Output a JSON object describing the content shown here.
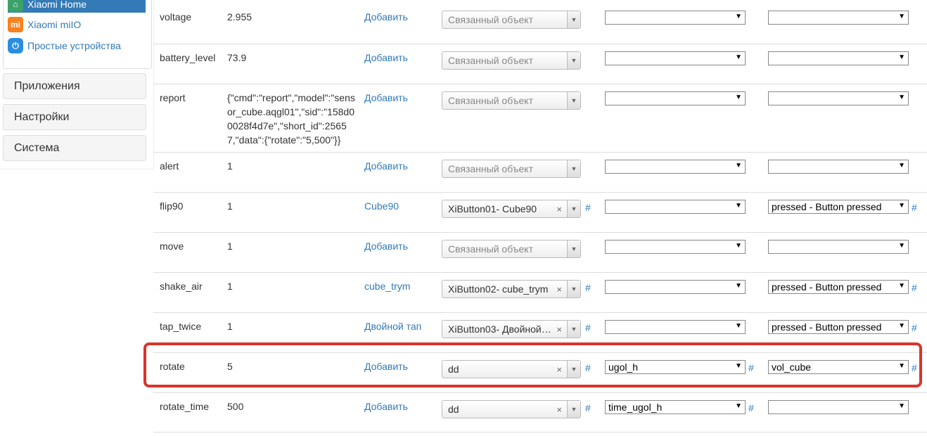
{
  "sidebar": {
    "subitems": [
      {
        "label": "Xiaomi Home",
        "icon": "xiaomi-home-icon"
      },
      {
        "label": "Xiaomi miIO",
        "icon": "mi-icon"
      },
      {
        "label": "Простые устройства",
        "icon": "power-icon"
      }
    ],
    "nav": [
      {
        "label": "Приложения"
      },
      {
        "label": "Настройки"
      },
      {
        "label": "Система"
      }
    ]
  },
  "placeholder_linked": "Связанный объект",
  "hash": "#",
  "rows": [
    {
      "name": "voltage",
      "value": "2.955",
      "link": "Добавить",
      "object": "",
      "prop": "",
      "method": ""
    },
    {
      "name": "battery_level",
      "value": "73.9",
      "link": "Добавить",
      "object": "",
      "prop": "",
      "method": ""
    },
    {
      "name": "report",
      "value": "{\"cmd\":\"report\",\"model\":\"sensor_cube.aqgl01\",\"sid\":\"158d00028f4d7e\",\"short_id\":25657,\"data\":{\"rotate\":\"5,500\"}}",
      "link": "Добавить",
      "object": "",
      "prop": "",
      "method": ""
    },
    {
      "name": "alert",
      "value": "1",
      "link": "Добавить",
      "object": "",
      "prop": "",
      "method": ""
    },
    {
      "name": "flip90",
      "value": "1",
      "link": "Cube90",
      "object": "XiButton01- Cube90",
      "prop": "",
      "method": "pressed - Button pressed"
    },
    {
      "name": "move",
      "value": "1",
      "link": "Добавить",
      "object": "",
      "prop": "",
      "method": ""
    },
    {
      "name": "shake_air",
      "value": "1",
      "link": "cube_trym",
      "object": "XiButton02- cube_trym",
      "prop": "",
      "method": "pressed - Button pressed"
    },
    {
      "name": "tap_twice",
      "value": "1",
      "link": "Двойной тап",
      "object": "XiButton03- Двойной…",
      "prop": "",
      "method": "pressed - Button pressed"
    },
    {
      "name": "rotate",
      "value": "5",
      "link": "Добавить",
      "object": "dd",
      "prop": "ugol_h",
      "method": "vol_cube"
    },
    {
      "name": "rotate_time",
      "value": "500",
      "link": "Добавить",
      "object": "dd",
      "prop": "time_ugol_h",
      "method": ""
    }
  ],
  "colors": {
    "accent": "#337ab7",
    "highlight": "#d9342b"
  }
}
